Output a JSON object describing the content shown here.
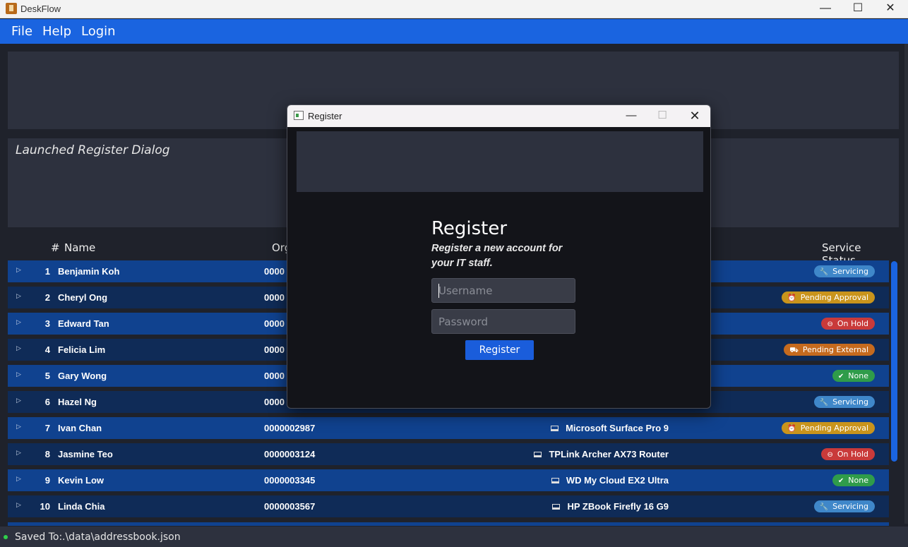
{
  "window": {
    "title": "DeskFlow",
    "min_glyph": "—",
    "max_glyph": "☐",
    "close_glyph": "✕"
  },
  "menu": {
    "file": "File",
    "help": "Help",
    "login": "Login"
  },
  "result_display": {
    "text": "Launched Register Dialog"
  },
  "list": {
    "headers": {
      "index": "#",
      "name": "Name",
      "org": "Org",
      "status": "Service Status"
    },
    "rows": [
      {
        "index": "1",
        "name": "Benjamin Koh",
        "org": "0000",
        "device": "",
        "status": {
          "label": "Servicing",
          "icon": "wrench-icon",
          "glyph": "🔧",
          "color": "#3f87c9"
        }
      },
      {
        "index": "2",
        "name": "Cheryl Ong",
        "org": "0000",
        "device": "",
        "status": {
          "label": "Pending Approval",
          "icon": "clock-icon",
          "glyph": "⏰",
          "color": "#c9941c"
        }
      },
      {
        "index": "3",
        "name": "Edward Tan",
        "org": "0000",
        "device": "",
        "status": {
          "label": "On Hold",
          "icon": "stop-icon",
          "glyph": "⊖",
          "color": "#c93a3a"
        }
      },
      {
        "index": "4",
        "name": "Felicia Lim",
        "org": "0000",
        "device": "",
        "status": {
          "label": "Pending External",
          "icon": "truck-icon",
          "glyph": "⛟",
          "color": "#c56a1e"
        }
      },
      {
        "index": "5",
        "name": "Gary Wong",
        "org": "0000",
        "device": "",
        "status": {
          "label": "None",
          "icon": "check-icon",
          "glyph": "✔",
          "color": "#2f9c4a"
        }
      },
      {
        "index": "6",
        "name": "Hazel Ng",
        "org": "0000",
        "device": "",
        "status": {
          "label": "Servicing",
          "icon": "wrench-icon",
          "glyph": "🔧",
          "color": "#3f87c9"
        }
      },
      {
        "index": "7",
        "name": "Ivan Chan",
        "org": "0000002987",
        "device": "Microsoft Surface Pro 9",
        "status": {
          "label": "Pending Approval",
          "icon": "clock-icon",
          "glyph": "⏰",
          "color": "#c9941c"
        }
      },
      {
        "index": "8",
        "name": "Jasmine Teo",
        "org": "0000003124",
        "device": "TPLink Archer AX73 Router",
        "status": {
          "label": "On Hold",
          "icon": "stop-icon",
          "glyph": "⊖",
          "color": "#c93a3a"
        }
      },
      {
        "index": "9",
        "name": "Kevin Low",
        "org": "0000003345",
        "device": "WD My Cloud EX2 Ultra",
        "status": {
          "label": "None",
          "icon": "check-icon",
          "glyph": "✔",
          "color": "#2f9c4a"
        }
      },
      {
        "index": "10",
        "name": "Linda Chia",
        "org": "0000003567",
        "device": "HP ZBook Firefly 16 G9",
        "status": {
          "label": "Servicing",
          "icon": "wrench-icon",
          "glyph": "🔧",
          "color": "#3f87c9"
        }
      }
    ]
  },
  "status_bar": {
    "label": "Saved To:",
    "path": ".\\data\\addressbook.json"
  },
  "dialog": {
    "title": "Register",
    "heading": "Register",
    "subtitle": "Register a new account for your IT staff.",
    "username_placeholder": "Username",
    "password_placeholder": "Password",
    "button_label": "Register"
  },
  "colors": {
    "accent": "#1a64e0",
    "row_odd": "#10428f",
    "row_even": "#0f2b57",
    "panel": "#2d313e"
  }
}
